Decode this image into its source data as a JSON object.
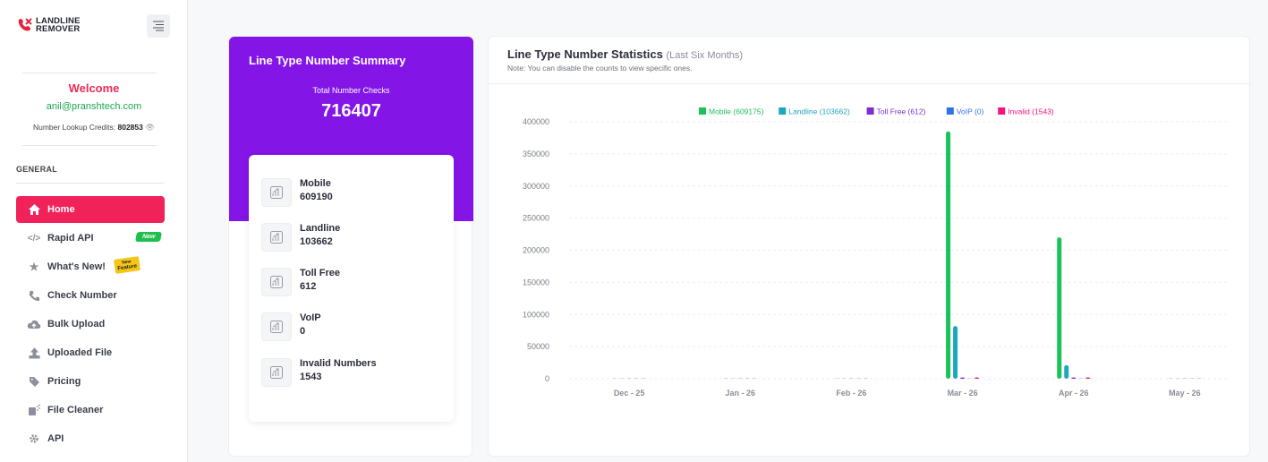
{
  "brand": {
    "line1": "LANDLINE",
    "line2": "REMOVER"
  },
  "welcome": {
    "title": "Welcome",
    "email": "anil@pranshtech.com",
    "credits_label": "Number Lookup Credits:",
    "credits_value": "802853"
  },
  "sidebar": {
    "section": "GENERAL",
    "items": [
      {
        "label": "Home",
        "icon": "home-icon",
        "active": true
      },
      {
        "label": "Rapid API",
        "icon": "code-icon",
        "badge": "New"
      },
      {
        "label": "What's New!",
        "icon": "star-icon",
        "badge": "Feature"
      },
      {
        "label": "Check Number",
        "icon": "phone-icon"
      },
      {
        "label": "Bulk Upload",
        "icon": "cloud-upload-icon"
      },
      {
        "label": "Uploaded File",
        "icon": "upload-icon"
      },
      {
        "label": "Pricing",
        "icon": "tag-icon"
      },
      {
        "label": "File Cleaner",
        "icon": "file-cleaner-icon"
      },
      {
        "label": "API",
        "icon": "api-icon"
      }
    ],
    "badge_new_label": "New",
    "badge_feature_label_1": "New",
    "badge_feature_label_2": "Feature"
  },
  "summary": {
    "title": "Line Type Number Summary",
    "subtitle": "Total Number Checks",
    "total": "716407",
    "stats": [
      {
        "label": "Mobile",
        "value": "609190"
      },
      {
        "label": "Landline",
        "value": "103662"
      },
      {
        "label": "Toll Free",
        "value": "612"
      },
      {
        "label": "VoIP",
        "value": "0"
      },
      {
        "label": "Invalid Numbers",
        "value": "1543"
      }
    ]
  },
  "chart_header": {
    "title": "Line Type Number Statistics",
    "title_suffix": "(Last Six Months)",
    "note": "Note: You can disable the counts to view specific ones."
  },
  "colors": {
    "accent": "#f1215a",
    "purple": "#8315e6",
    "mobile": "#1cc15a",
    "landline": "#1ba7bd",
    "toll_free": "#7a2fd0",
    "voip": "#2f73e6",
    "invalid": "#f0147c"
  },
  "chart_data": {
    "type": "bar",
    "categories": [
      "Dec - 25",
      "Jan - 26",
      "Feb - 26",
      "Mar - 26",
      "Apr - 26",
      "May - 26"
    ],
    "series": [
      {
        "name": "Mobile (609175)",
        "color": "#1cc15a",
        "values": [
          0,
          0,
          0,
          385000,
          220000,
          0
        ]
      },
      {
        "name": "Landline (103662)",
        "color": "#1ba7bd",
        "values": [
          0,
          0,
          0,
          82000,
          21000,
          0
        ]
      },
      {
        "name": "Toll Free (612)",
        "color": "#7a2fd0",
        "values": [
          0,
          0,
          0,
          400,
          200,
          0
        ]
      },
      {
        "name": "VoIP (0)",
        "color": "#2f73e6",
        "values": [
          0,
          0,
          0,
          0,
          0,
          0
        ]
      },
      {
        "name": "Invalid (1543)",
        "color": "#f0147c",
        "values": [
          0,
          0,
          0,
          1200,
          300,
          0
        ]
      }
    ],
    "yticks": [
      0,
      50000,
      100000,
      150000,
      200000,
      250000,
      300000,
      350000,
      400000
    ],
    "ylim": [
      0,
      400000
    ],
    "grid": true,
    "legend_position": "top"
  }
}
